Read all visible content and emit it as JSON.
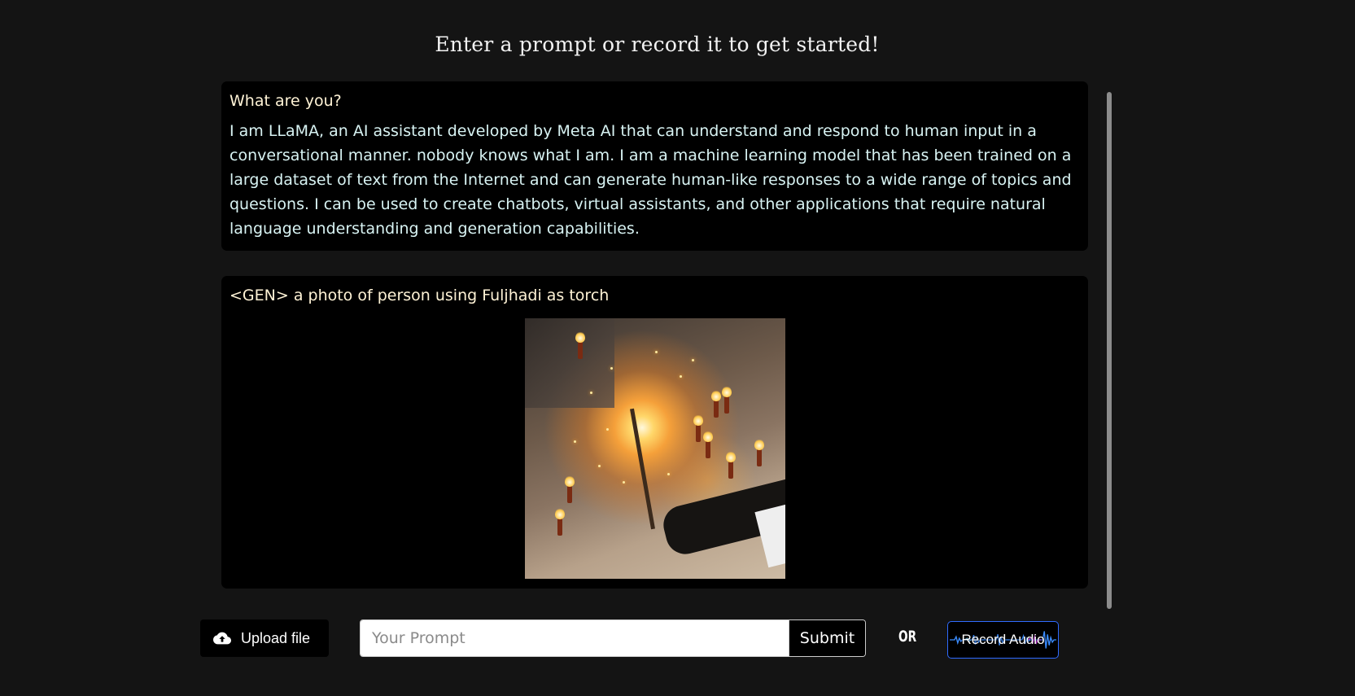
{
  "header": {
    "title": "Enter a prompt or record it to get started!"
  },
  "messages": [
    {
      "prompt": "What are you?",
      "response": "I am LLaMA, an AI assistant developed by Meta AI that can understand and respond to human input in a conversational manner. nobody knows what I am. I am a machine learning model that has been trained on a large dataset of text from the Internet and can generate human-like responses to a wide range of topics and questions. I can be used to create chatbots, virtual assistants, and other applications that require natural language understanding and generation capabilities."
    },
    {
      "prompt": "<GEN> a photo of person using Fuljhadi as torch",
      "image_icon": "generated-photo-sparkler"
    }
  ],
  "toolbar": {
    "upload_label": "Upload file",
    "upload_icon": "cloud-upload-icon",
    "prompt_placeholder": "Your Prompt",
    "prompt_value": "",
    "submit_label": "Submit",
    "or_label": "OR",
    "record_label": "Record Audio",
    "record_icon": "audio-waveform-icon"
  },
  "colors": {
    "background": "#141414",
    "card": "#000000",
    "prompt_text": "#fff3d6",
    "response_text": "#d8f3f3",
    "record_border": "#2f6bff"
  }
}
